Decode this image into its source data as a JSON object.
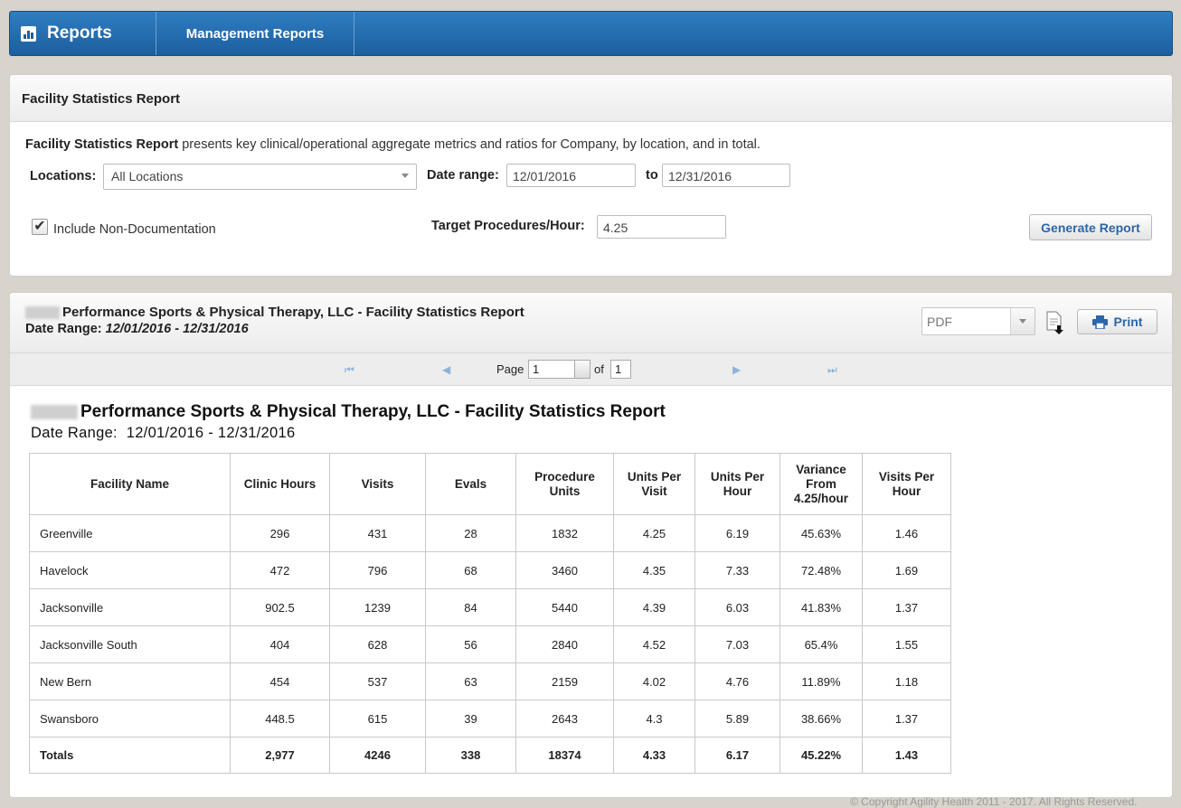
{
  "nav": {
    "brand": "Reports",
    "items": [
      "Management Reports"
    ]
  },
  "criteria": {
    "title": "Facility Statistics Report",
    "description_bold": "Facility Statistics Report",
    "description_rest": " presents key clinical/operational aggregate metrics and ratios for Company, by location, and in total.",
    "locations_label": "Locations:",
    "locations_value": "All Locations",
    "date_range_label": "Date range:",
    "date_from": "12/01/2016",
    "to_label": "to",
    "date_to": "12/31/2016",
    "include_label": "Include Non-Documentation",
    "include_checked": true,
    "target_label": "Target Procedures/Hour:",
    "target_value": "4.25",
    "generate_label": "Generate Report"
  },
  "viewer": {
    "title": "Performance Sports & Physical Therapy, LLC - Facility Statistics Report",
    "range_label": "Date Range: ",
    "range_value": "12/01/2016 - 12/31/2016",
    "format_value": "PDF",
    "print_label": "Print",
    "page_label": "Page",
    "page_value": "1",
    "of_label": "of",
    "page_total": "1"
  },
  "report": {
    "title": "Performance Sports & Physical Therapy, LLC - Facility Statistics Report",
    "range_label": "Date Range:",
    "range_value": "12/01/2016 - 12/31/2016",
    "columns": [
      [
        "Facility Name"
      ],
      [
        "Clinic Hours"
      ],
      [
        "Visits"
      ],
      [
        "Evals"
      ],
      [
        "Procedure",
        "Units"
      ],
      [
        "Units Per",
        "Visit"
      ],
      [
        "Units Per",
        "Hour"
      ],
      [
        "Variance",
        "From",
        "4.25/hour"
      ],
      [
        "Visits Per",
        "Hour"
      ]
    ],
    "rows": [
      [
        "Greenville",
        "296",
        "431",
        "28",
        "1832",
        "4.25",
        "6.19",
        "45.63%",
        "1.46"
      ],
      [
        "Havelock",
        "472",
        "796",
        "68",
        "3460",
        "4.35",
        "7.33",
        "72.48%",
        "1.69"
      ],
      [
        "Jacksonville",
        "902.5",
        "1239",
        "84",
        "5440",
        "4.39",
        "6.03",
        "41.83%",
        "1.37"
      ],
      [
        "Jacksonville South",
        "404",
        "628",
        "56",
        "2840",
        "4.52",
        "7.03",
        "65.4%",
        "1.55"
      ],
      [
        "New Bern",
        "454",
        "537",
        "63",
        "2159",
        "4.02",
        "4.76",
        "11.89%",
        "1.18"
      ],
      [
        "Swansboro",
        "448.5",
        "615",
        "39",
        "2643",
        "4.3",
        "5.89",
        "38.66%",
        "1.37"
      ]
    ],
    "totals": [
      "Totals",
      "2,977",
      "4246",
      "338",
      "18374",
      "4.33",
      "6.17",
      "45.22%",
      "1.43"
    ]
  },
  "footer": {
    "copyright": "© Copyright Agility Health 2011 - 2017. All Rights Reserved."
  },
  "colors": {
    "nav_blue": "#1c5f9e",
    "button_text": "#2b66a8",
    "page_background": "#d8d4cb"
  }
}
